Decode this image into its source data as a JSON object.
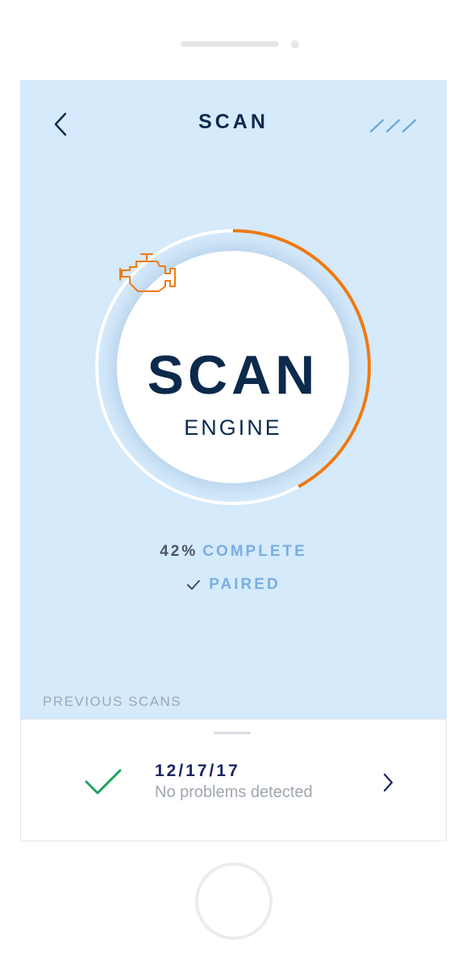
{
  "header": {
    "title": "SCAN"
  },
  "dial": {
    "title": "SCAN",
    "subtitle": "ENGINE",
    "progress": 0.42
  },
  "status": {
    "percent": "42%",
    "complete_label": "COMPLETE",
    "paired_label": "PAIRED"
  },
  "previous_scans": {
    "label": "PREVIOUS SCANS",
    "items": [
      {
        "date": "12/17/17",
        "status": "No problems detected"
      }
    ]
  },
  "colors": {
    "accent": "#f07a10",
    "navy": "#0b2a4c",
    "light_blue": "#7aaee2",
    "success": "#1fa25b",
    "background": "#d5eafb"
  }
}
